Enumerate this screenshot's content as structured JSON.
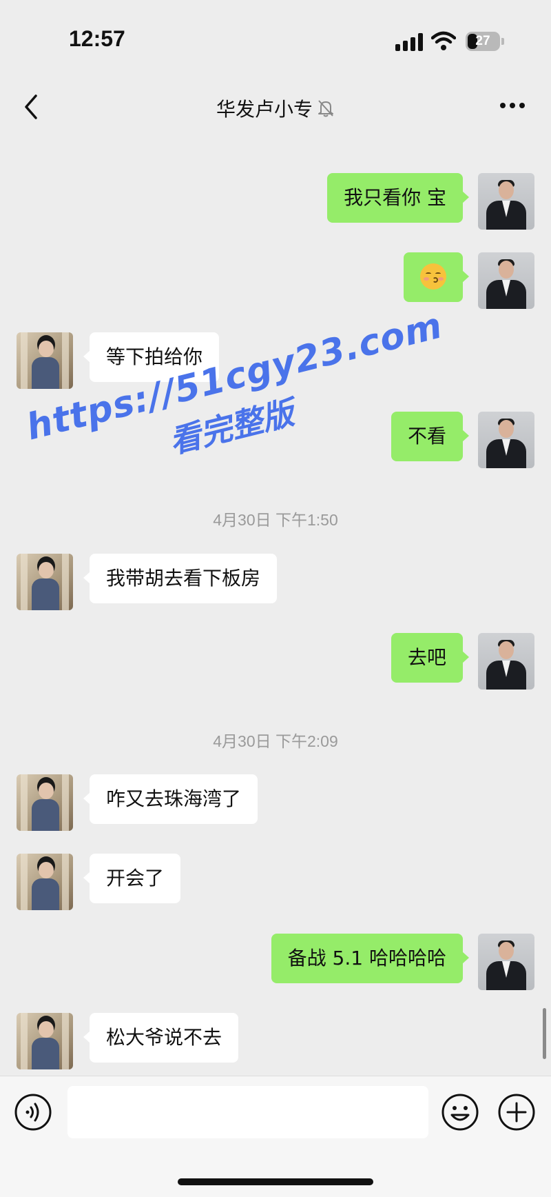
{
  "status_bar": {
    "time": "12:57",
    "battery": "27"
  },
  "header": {
    "title": "华发卢小专"
  },
  "messages": {
    "m1": "我只看你 宝",
    "m2_emoji": "smiling-face-emoji",
    "m3": "等下拍给你",
    "m4": "不看",
    "ts1": "4月30日 下午1:50",
    "m5": "我带胡去看下板房",
    "m6": "去吧",
    "ts2": "4月30日 下午2:09",
    "m7": "咋又去珠海湾了",
    "m8": "开会了",
    "m9": "备战 5.1 哈哈哈哈",
    "m10": "松大爷说不去"
  },
  "watermark": {
    "line1": "https://51cgy23.com",
    "line2": "看完整版"
  },
  "input_bar": {
    "placeholder": ""
  },
  "colors": {
    "sent_bubble": "#95ec69",
    "received_bubble": "#ffffff",
    "background": "#ededed",
    "watermark": "#4a73ea"
  },
  "icons": [
    "back-icon",
    "mute-icon",
    "more-icon",
    "voice-icon",
    "emoji-icon",
    "plus-icon",
    "signal-icon",
    "wifi-icon",
    "battery-icon"
  ]
}
